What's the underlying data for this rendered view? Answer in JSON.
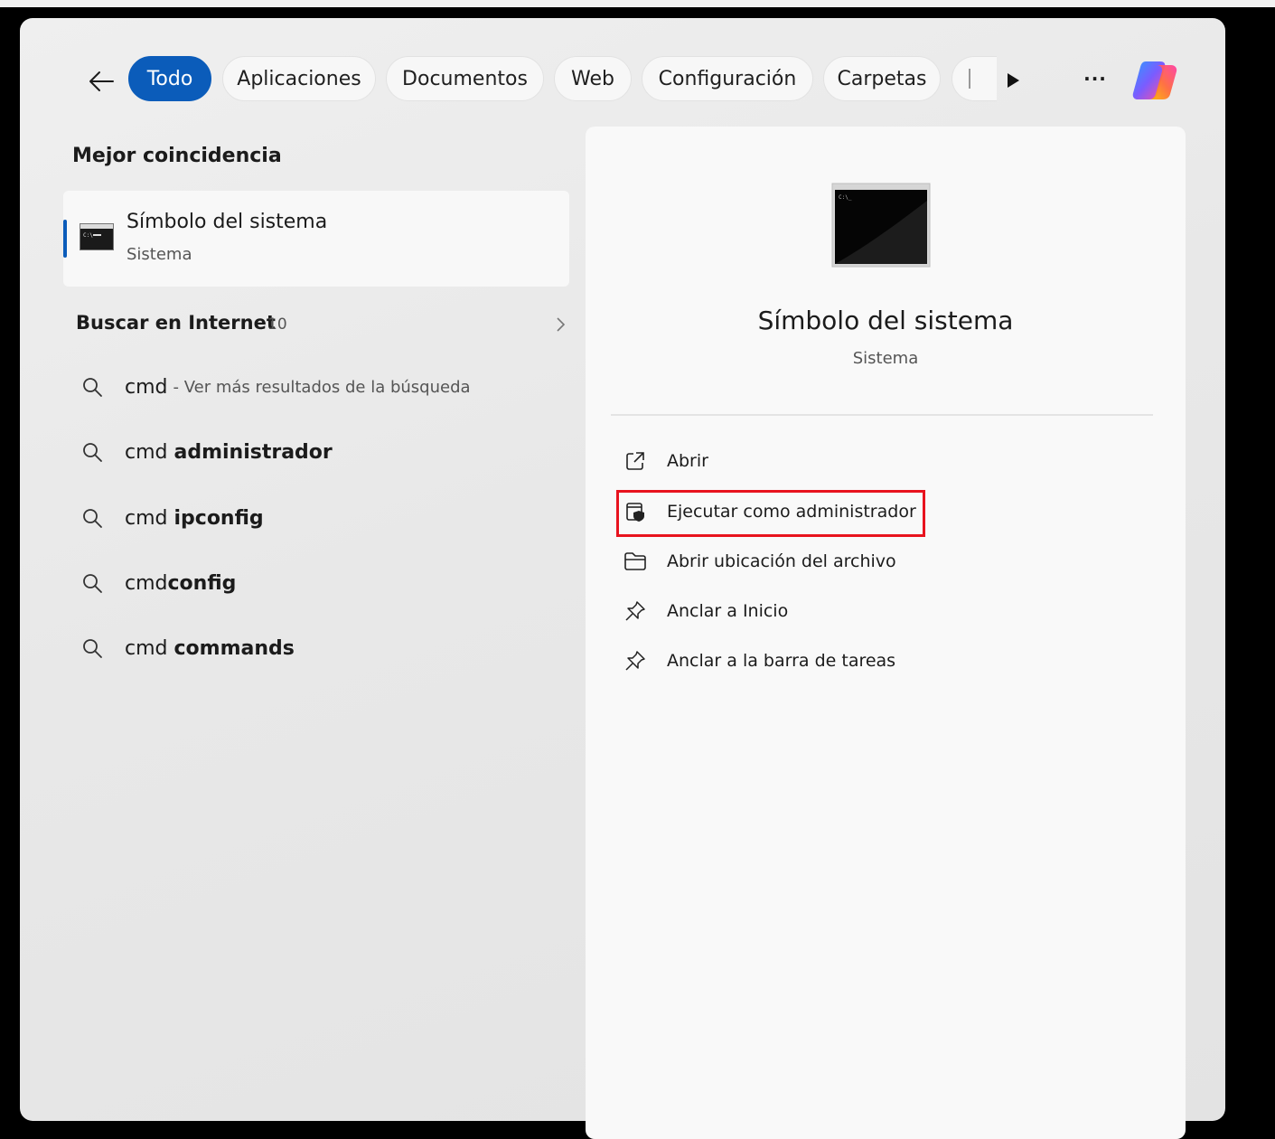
{
  "filters": {
    "back_label": "",
    "chips": [
      {
        "label": "Todo",
        "active": true
      },
      {
        "label": "Aplicaciones",
        "active": false
      },
      {
        "label": "Documentos",
        "active": false
      },
      {
        "label": "Web",
        "active": false
      },
      {
        "label": "Configuración",
        "active": false
      },
      {
        "label": "Carpetas",
        "active": false
      }
    ],
    "more_label": "···"
  },
  "best_match": {
    "section_title": "Mejor coincidencia",
    "name": "Símbolo del sistema",
    "kind": "Sistema"
  },
  "web_search": {
    "label": "Buscar en Internet",
    "count": "10",
    "results": [
      {
        "plain": "cmd",
        "bold": "",
        "sub": "- Ver más resultados de la búsqueda"
      },
      {
        "plain": "cmd ",
        "bold": "administrador",
        "sub": ""
      },
      {
        "plain": "cmd ",
        "bold": "ipconfig",
        "sub": ""
      },
      {
        "plain": "cmd",
        "bold": "config",
        "sub": ""
      },
      {
        "plain": "cmd ",
        "bold": "commands",
        "sub": ""
      }
    ]
  },
  "preview": {
    "title": "Símbolo del sistema",
    "kind": "Sistema",
    "actions": [
      {
        "label": "Abrir",
        "icon": "open-external-icon"
      },
      {
        "label": "Ejecutar como administrador",
        "icon": "shield-admin-icon",
        "highlighted": true
      },
      {
        "label": "Abrir ubicación del archivo",
        "icon": "folder-icon"
      },
      {
        "label": "Anclar a Inicio",
        "icon": "pin-icon"
      },
      {
        "label": "Anclar a la barra de tareas",
        "icon": "pin-icon"
      }
    ]
  },
  "colors": {
    "accent": "#0b5cba",
    "highlight": "#e8131e"
  }
}
